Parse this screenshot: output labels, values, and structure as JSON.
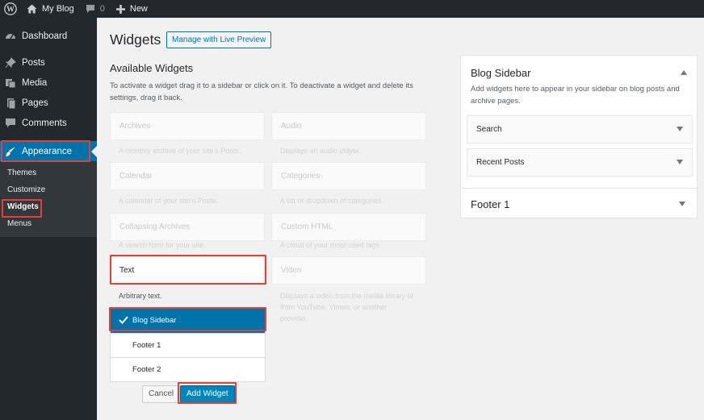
{
  "adminbar": {
    "site_name": "My Blog",
    "comments_count": "0",
    "new_label": "New"
  },
  "sidebar": {
    "items": [
      {
        "label": "Dashboard",
        "icon": "dashboard-icon"
      },
      {
        "label": "Posts",
        "icon": "pin-icon"
      },
      {
        "label": "Media",
        "icon": "media-icon"
      },
      {
        "label": "Pages",
        "icon": "pages-icon"
      },
      {
        "label": "Comments",
        "icon": "comment-icon"
      },
      {
        "label": "Appearance",
        "icon": "brush-icon"
      }
    ],
    "submenu": [
      "Themes",
      "Customize",
      "Widgets",
      "Menus"
    ]
  },
  "main": {
    "title": "Widgets",
    "live_preview": "Manage with Live Preview",
    "available_title": "Available Widgets",
    "available_desc": "To activate a widget drag it to a sidebar or click on it. To deactivate a widget and delete its settings, drag it back.",
    "widgets": [
      {
        "name": "Archives",
        "desc": "A monthly archive of your site's Posts."
      },
      {
        "name": "Audio",
        "desc": "Displays an audio player."
      },
      {
        "name": "Calendar",
        "desc": "A calendar of your site's Posts."
      },
      {
        "name": "Categories",
        "desc": "A list or dropdown of categories."
      },
      {
        "name": "Collapsing Archives",
        "desc": "A search form for your site."
      },
      {
        "name": "Custom HTML",
        "desc": "A cloud of your most used tags."
      },
      {
        "name": "Text",
        "desc": "Arbitrary text."
      },
      {
        "name": "Video",
        "desc": "Displays a video from the media library or from YouTube, Vimeo, or another provider."
      }
    ],
    "chooser": [
      "Blog Sidebar",
      "Footer 1",
      "Footer 2"
    ],
    "cancel_label": "Cancel",
    "add_label": "Add Widget"
  },
  "sidebars": {
    "blog_title": "Blog Sidebar",
    "blog_desc": "Add widgets here to appear in your sidebar on blog posts and archive pages.",
    "blog_widgets": [
      "Search",
      "Recent Posts"
    ],
    "footer_title": "Footer 1"
  },
  "colors": {
    "accent": "#0073aa",
    "highlight": "#e3403a",
    "admin_bg": "#23282d"
  }
}
